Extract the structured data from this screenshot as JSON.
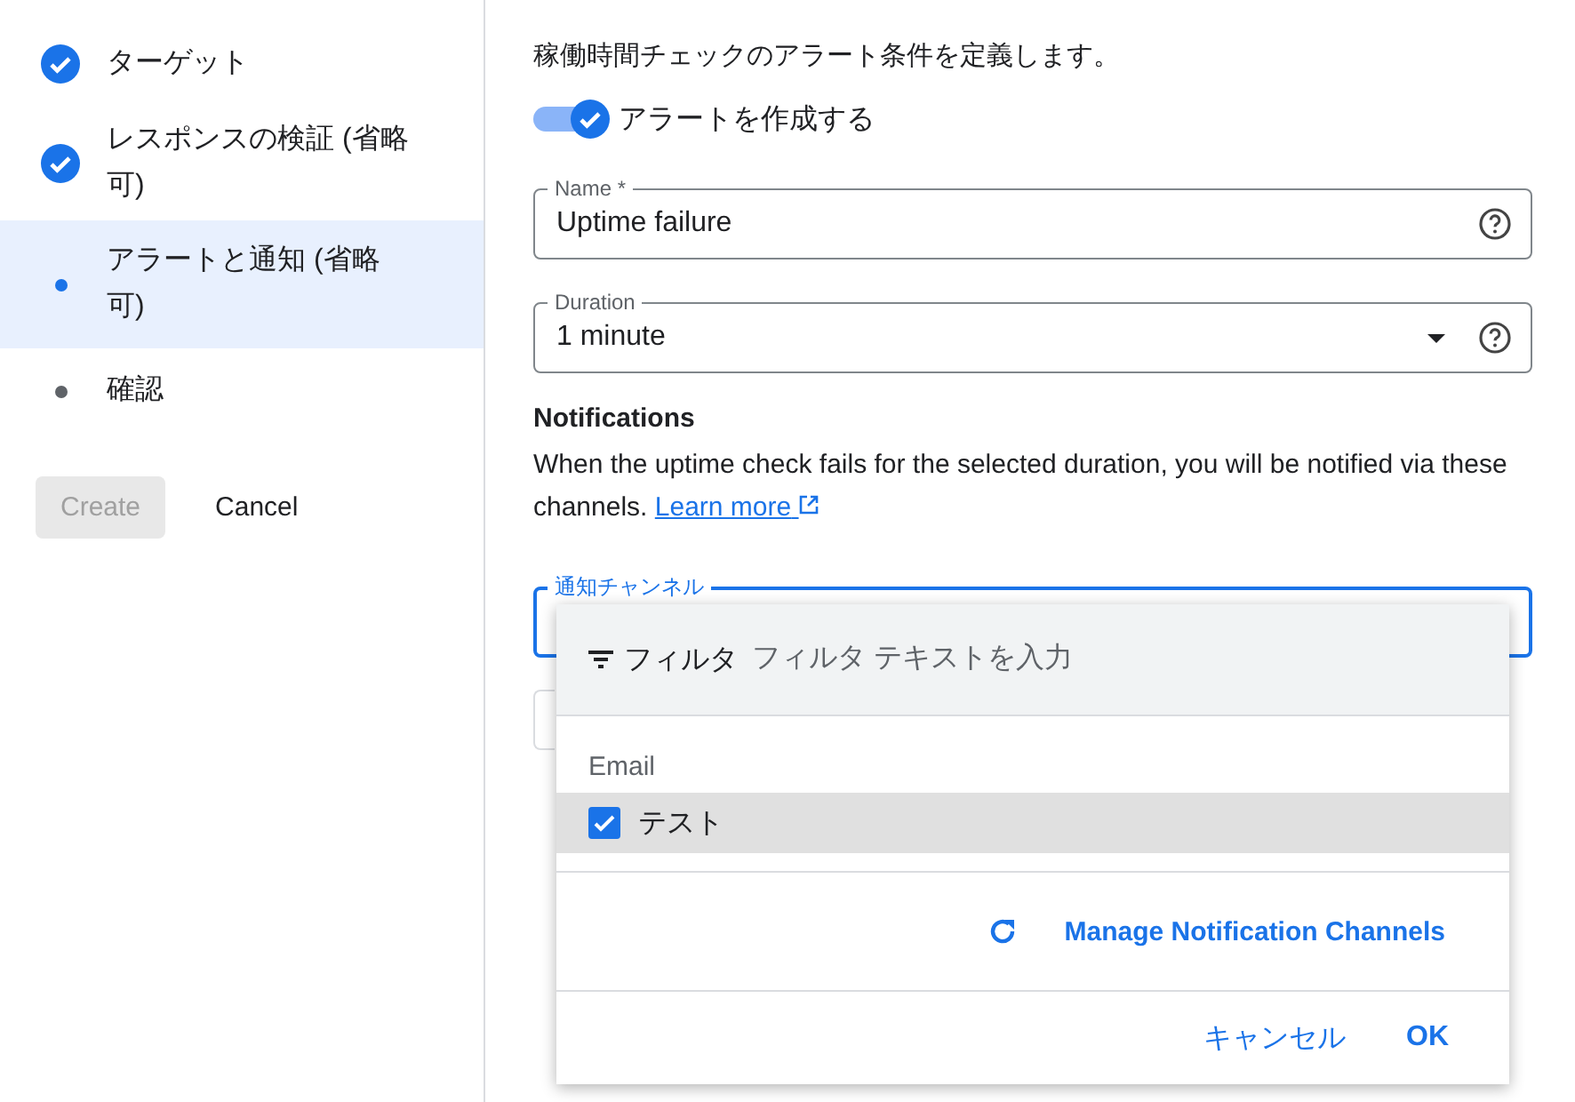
{
  "steps": [
    {
      "label": "ターゲット",
      "kind": "done",
      "selected": false
    },
    {
      "label": "レスポンスの検証 (省略可)",
      "kind": "done",
      "selected": false
    },
    {
      "label": "アラートと通知 (省略可)",
      "kind": "current",
      "selected": true
    },
    {
      "label": "確認",
      "kind": "pending",
      "selected": false
    }
  ],
  "actions": [
    {
      "label": "Create",
      "disabled": true
    },
    {
      "label": "Cancel",
      "disabled": false
    }
  ],
  "description": "稼働時間チェックのアラート条件を定義します。",
  "alert_toggle": {
    "label": "アラートを作成する",
    "on": true
  },
  "name_field": {
    "label": "Name *",
    "value": "Uptime failure"
  },
  "duration_field": {
    "label": "Duration",
    "value": "1 minute"
  },
  "notifications": {
    "heading": "Notifications",
    "text": "When the uptime check fails for the selected duration, you will be notified via these channels.",
    "link": "Learn more"
  },
  "channel_field": {
    "label": "通知チャンネル"
  },
  "dropdown": {
    "filter_label": "フィルタ",
    "filter_placeholder": "フィルタ テキストを入力",
    "group": "Email",
    "options": [
      {
        "label": "テスト",
        "checked": true
      }
    ],
    "manage": "Manage Notification Channels",
    "cancel": "キャンセル",
    "ok": "OK"
  }
}
